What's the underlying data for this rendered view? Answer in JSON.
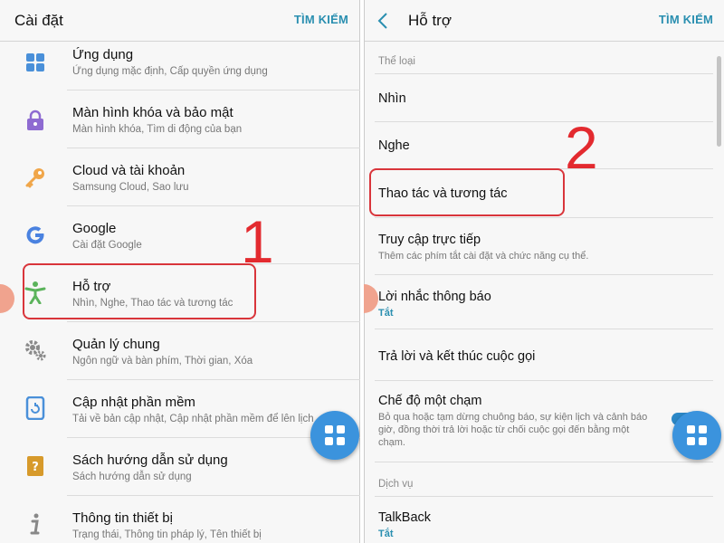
{
  "left_panel": {
    "title": "Cài đặt",
    "search_label": "TÌM KIẾM",
    "items": [
      {
        "title": "Ứng dụng",
        "subtitle": "Ứng dụng mặc định, Cấp quyền ứng dụng",
        "icon": "apps-grid-icon"
      },
      {
        "title": "Màn hình khóa và bảo mật",
        "subtitle": "Màn hình khóa, Tìm di động của bạn",
        "icon": "lock-icon"
      },
      {
        "title": "Cloud và tài khoản",
        "subtitle": "Samsung Cloud, Sao lưu",
        "icon": "key-icon"
      },
      {
        "title": "Google",
        "subtitle": "Cài đặt Google",
        "icon": "google-icon"
      },
      {
        "title": "Hỗ trợ",
        "subtitle": "Nhìn, Nghe, Thao tác và tương tác",
        "icon": "accessibility-icon"
      },
      {
        "title": "Quản lý chung",
        "subtitle": "Ngôn ngữ và bàn phím, Thời gian, Xóa",
        "icon": "gears-icon"
      },
      {
        "title": "Cập nhật phần mềm",
        "subtitle": "Tải về bản cập nhật, Cập nhật phần mềm để lên lịch",
        "icon": "software-update-icon"
      },
      {
        "title": "Sách hướng dẫn sử dụng",
        "subtitle": "Sách hướng dẫn sử dụng",
        "icon": "user-manual-icon"
      },
      {
        "title": "Thông tin thiết bị",
        "subtitle": "Trạng thái, Thông tin pháp lý, Tên thiết bị",
        "icon": "info-icon"
      }
    ],
    "annotation": "1"
  },
  "right_panel": {
    "title": "Hỗ trợ",
    "search_label": "TÌM KIẾM",
    "category_1": "Thể loại",
    "items": [
      {
        "title": "Nhìn"
      },
      {
        "title": "Nghe"
      },
      {
        "title": "Thao tác và tương tác"
      },
      {
        "title": "Truy cập trực tiếp",
        "subtitle": "Thêm các phím tắt cài đặt và chức năng cụ thể."
      },
      {
        "title": "Lời nhắc thông báo",
        "value": "Tắt"
      },
      {
        "title": "Trả lời và kết thúc cuộc gọi"
      },
      {
        "title": "Chế độ một chạm",
        "subtitle": "Bỏ qua hoặc tạm dừng chuông báo, sự kiện lịch và cảnh báo giờ, đồng thời trả lời hoặc từ chối cuộc gọi đến bằng một chạm."
      },
      {
        "title": "TalkBack",
        "value": "Tắt"
      }
    ],
    "category_2": "Dịch vụ",
    "annotation": "2"
  },
  "colors": {
    "accent": "#2a8fb0",
    "highlight": "#d9353b",
    "fab": "#3b93dd"
  }
}
